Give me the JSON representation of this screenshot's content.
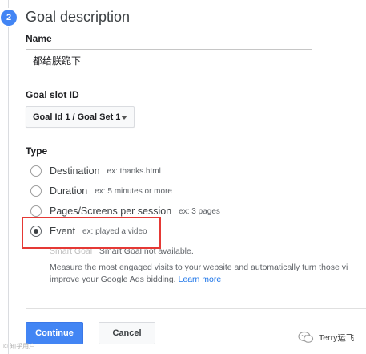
{
  "step": {
    "number": "2",
    "title": "Goal description"
  },
  "name_field": {
    "label": "Name",
    "value": "都给朕跪下"
  },
  "goal_slot": {
    "label": "Goal slot ID",
    "selected": "Goal Id 1 / Goal Set 1"
  },
  "type": {
    "label": "Type",
    "options": [
      {
        "label": "Destination",
        "example": "ex: thanks.html",
        "checked": false
      },
      {
        "label": "Duration",
        "example": "ex: 5 minutes or more",
        "checked": false
      },
      {
        "label": "Pages/Screens per session",
        "example": "ex: 3 pages",
        "checked": false
      },
      {
        "label": "Event",
        "example": "ex: played a video",
        "checked": true
      }
    ]
  },
  "smart_goal": {
    "label": "Smart Goal",
    "note": "Smart Goal not available."
  },
  "measure": {
    "line1": "Measure the most engaged visits to your website and automatically turn those vi",
    "line2": "improve your Google Ads bidding.",
    "link": "Learn more"
  },
  "buttons": {
    "continue": "Continue",
    "cancel": "Cancel"
  },
  "watermark": {
    "left": "© 知乎用户",
    "right": "Terry运飞"
  },
  "colors": {
    "accent": "#4285f4",
    "highlight": "#e53935",
    "link": "#1a73e8"
  }
}
